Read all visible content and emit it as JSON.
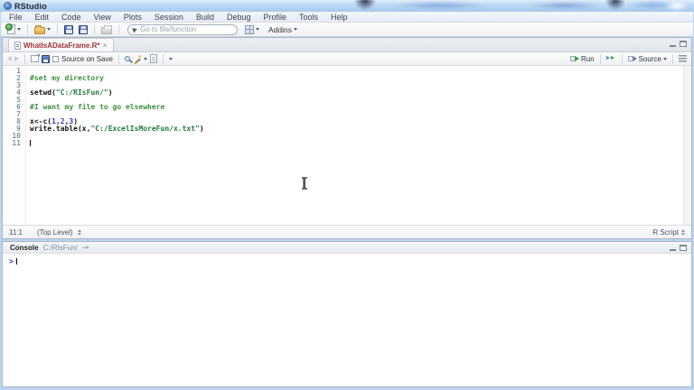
{
  "titlebar": {
    "title": "RStudio"
  },
  "menubar": {
    "items": [
      "File",
      "Edit",
      "Code",
      "View",
      "Plots",
      "Session",
      "Build",
      "Debug",
      "Profile",
      "Tools",
      "Help"
    ]
  },
  "toolbar": {
    "goto_placeholder": "Go to file/function",
    "addins_label": "Addins"
  },
  "editor": {
    "tab_label": "WhatIsADataFrame.R*",
    "toolbar": {
      "source_on_save_label": "Source on Save",
      "run_label": "Run",
      "source_label": "Source"
    },
    "lines": [
      {
        "num": "1",
        "segments": []
      },
      {
        "num": "2",
        "segments": [
          {
            "text": "#set my directory",
            "type": "comment"
          }
        ]
      },
      {
        "num": "3",
        "segments": []
      },
      {
        "num": "4",
        "segments": [
          {
            "text": "setwd(",
            "type": "plain"
          },
          {
            "text": "\"C:/RIsFun/\"",
            "type": "string"
          },
          {
            "text": ")",
            "type": "plain"
          }
        ]
      },
      {
        "num": "5",
        "segments": []
      },
      {
        "num": "6",
        "segments": [
          {
            "text": "#I want my file to go elsewhere",
            "type": "comment"
          }
        ]
      },
      {
        "num": "7",
        "segments": []
      },
      {
        "num": "8",
        "segments": [
          {
            "text": "x<-c(",
            "type": "plain"
          },
          {
            "text": "1",
            "type": "number"
          },
          {
            "text": ",",
            "type": "plain"
          },
          {
            "text": "2",
            "type": "number"
          },
          {
            "text": ",",
            "type": "plain"
          },
          {
            "text": "3",
            "type": "number"
          },
          {
            "text": ")",
            "type": "plain"
          }
        ]
      },
      {
        "num": "9",
        "segments": [
          {
            "text": "write.table(x,",
            "type": "plain"
          },
          {
            "text": "\"C:/ExcelIsMoreFun/x.txt\"",
            "type": "string"
          },
          {
            "text": ")",
            "type": "plain"
          }
        ]
      },
      {
        "num": "10",
        "segments": []
      },
      {
        "num": "11",
        "segments": [],
        "caret": true
      }
    ],
    "status": {
      "position": "11:1",
      "scope": "(Top Level)",
      "file_type": "R Script"
    }
  },
  "console": {
    "title": "Console",
    "path": "C:/RIsFun/",
    "prompt": ">"
  },
  "colors": {
    "tab_filename": "#a03535",
    "comment": "#3d9140",
    "string": "#1f7a3d",
    "number": "#3b3bd1",
    "prompt": "#2233cc",
    "run_arrow": "#2e9e2e",
    "titlebar": "#b7d2ef"
  }
}
